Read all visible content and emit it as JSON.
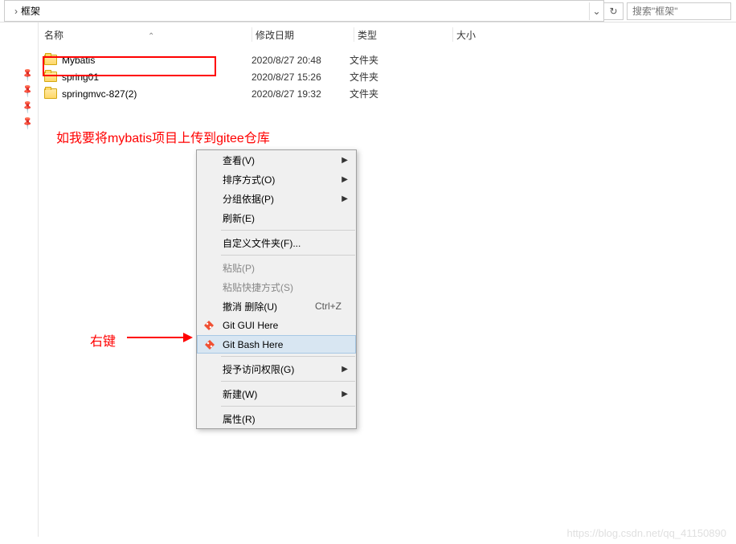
{
  "address": {
    "separator": "›",
    "folder": "框架",
    "search_placeholder": "搜索\"框架\""
  },
  "columns": {
    "name": "名称",
    "date": "修改日期",
    "type": "类型",
    "size": "大小"
  },
  "files": [
    {
      "name": "Mybatis",
      "date": "2020/8/27 20:48",
      "type": "文件夹"
    },
    {
      "name": "spring01",
      "date": "2020/8/27 15:26",
      "type": "文件夹"
    },
    {
      "name": "springmvc-827(2)",
      "date": "2020/8/27 19:32",
      "type": "文件夹"
    }
  ],
  "annotations": {
    "upload_note": "如我要将mybatis项目上传到gitee仓库",
    "right_click": "右键"
  },
  "context_menu": {
    "view": "查看(V)",
    "sort": "排序方式(O)",
    "group": "分组依据(P)",
    "refresh": "刷新(E)",
    "custom_folder": "自定义文件夹(F)...",
    "paste": "粘贴(P)",
    "paste_shortcut": "粘贴快捷方式(S)",
    "undo": "撤消 删除(U)",
    "undo_key": "Ctrl+Z",
    "git_gui": "Git GUI Here",
    "git_bash": "Git Bash Here",
    "grant_access": "授予访问权限(G)",
    "new": "新建(W)",
    "properties": "属性(R)"
  },
  "watermark": "https://blog.csdn.net/qq_41150890"
}
